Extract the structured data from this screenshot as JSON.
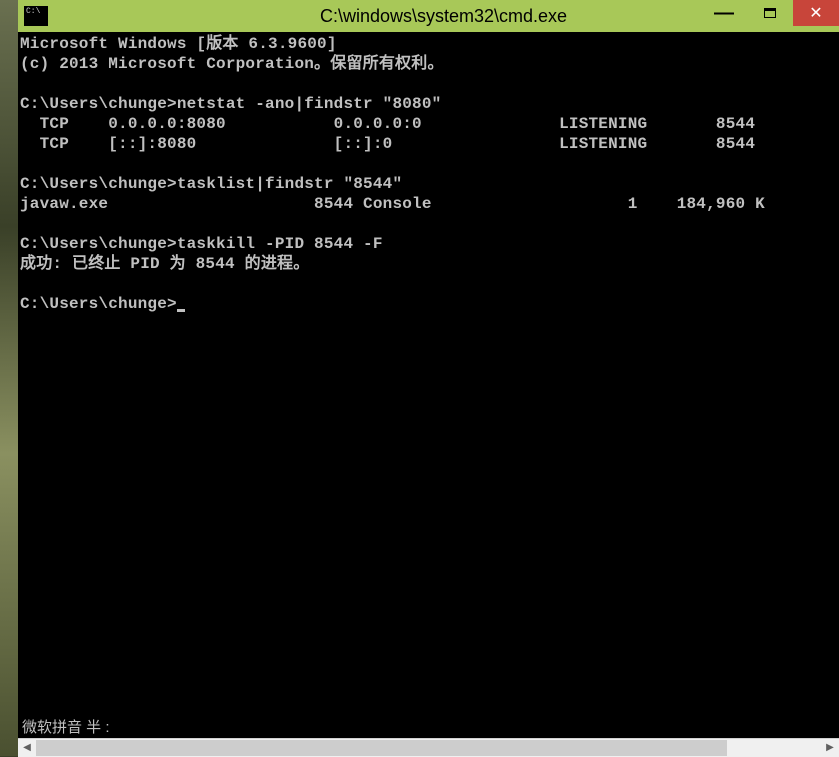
{
  "window": {
    "title": "C:\\windows\\system32\\cmd.exe"
  },
  "terminal": {
    "line1": "Microsoft Windows [版本 6.3.9600]",
    "line2": "(c) 2013 Microsoft Corporation。保留所有权利。",
    "blank1": "",
    "prompt1": "C:\\Users\\chunge>netstat -ano|findstr \"8080\"",
    "out1": "  TCP    0.0.0.0:8080           0.0.0.0:0              LISTENING       8544",
    "out2": "  TCP    [::]:8080              [::]:0                 LISTENING       8544",
    "blank2": "",
    "prompt2": "C:\\Users\\chunge>tasklist|findstr \"8544\"",
    "out3": "javaw.exe                     8544 Console                    1    184,960 K",
    "blank3": "",
    "prompt3": "C:\\Users\\chunge>taskkill -PID 8544 -F",
    "out4": "成功: 已终止 PID 为 8544 的进程。",
    "blank4": "",
    "prompt4": "C:\\Users\\chunge>"
  },
  "ime": {
    "text": "微软拼音 半 :"
  }
}
